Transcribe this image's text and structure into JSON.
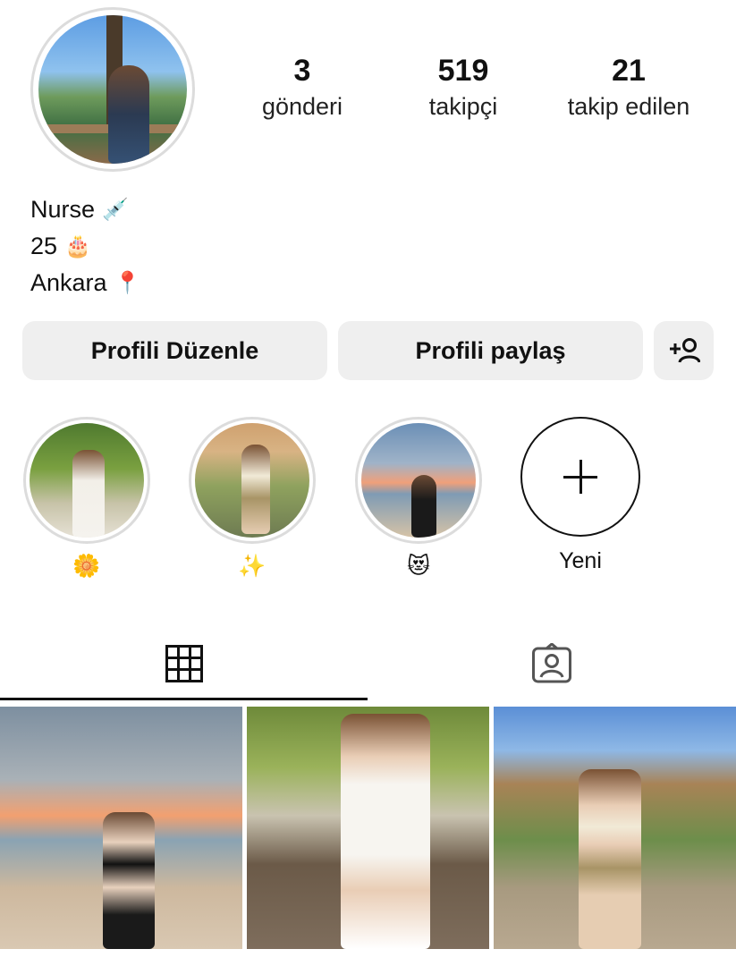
{
  "profile": {
    "stats": {
      "posts": {
        "value": "3",
        "label": "gönderi"
      },
      "followers": {
        "value": "519",
        "label": "takipçi"
      },
      "following": {
        "value": "21",
        "label": "takip edilen"
      }
    },
    "bio": [
      {
        "text": "Nurse",
        "emoji": "💉"
      },
      {
        "text": "25",
        "emoji": "🎂"
      },
      {
        "text": "Ankara",
        "emoji": "📍"
      }
    ]
  },
  "buttons": {
    "edit_label": "Profili Düzenle",
    "share_label": "Profili paylaş",
    "add_person_icon": "add-person-icon"
  },
  "highlights": [
    {
      "label": "🌼"
    },
    {
      "label": "✨"
    },
    {
      "label": "😻"
    },
    {
      "label": "Yeni"
    }
  ],
  "tabs": [
    {
      "icon": "grid-icon",
      "active": true
    },
    {
      "icon": "tagged-icon",
      "active": false
    }
  ],
  "colors": {
    "button_bg": "#efefef",
    "ring": "#dcdcdc",
    "text": "#111111"
  }
}
